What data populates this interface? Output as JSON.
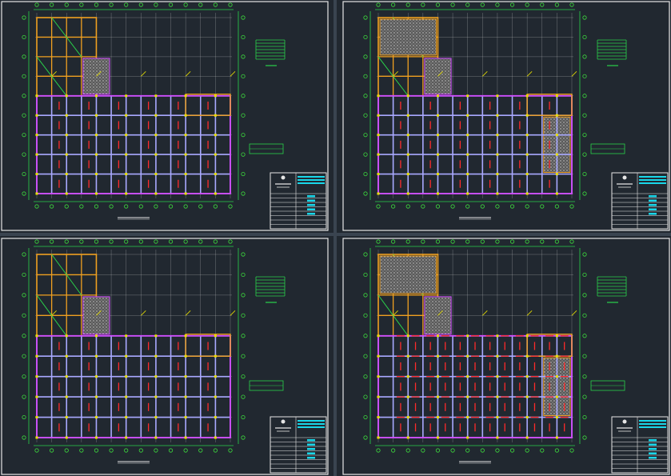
{
  "app": {
    "view": "CAD model space",
    "sheet_count": 4
  },
  "colors": {
    "background": "#212830",
    "sheet_border": "#e6e6e6",
    "grid_axis": "#d8d8d8",
    "axis_bubble": "#3ddc3d",
    "dimension": "#2ad14a",
    "beam_purple": "#d14cff",
    "beam_lavender": "#a9a9ff",
    "beam_orange": "#f0a020",
    "rebar_red": "#ff2a2a",
    "annotation_yellow": "#e8e000",
    "hatch": "#bdbdbd",
    "title_cyan": "#19d6e8"
  },
  "sheets": [
    {
      "id": "sheet-1",
      "position": "top-left",
      "variant": "framing-plan"
    },
    {
      "id": "sheet-2",
      "position": "top-right",
      "variant": "framing-plan-hatched"
    },
    {
      "id": "sheet-3",
      "position": "bottom-left",
      "variant": "framing-plan"
    },
    {
      "id": "sheet-4",
      "position": "bottom-right",
      "variant": "reinforcement-plan"
    }
  ]
}
